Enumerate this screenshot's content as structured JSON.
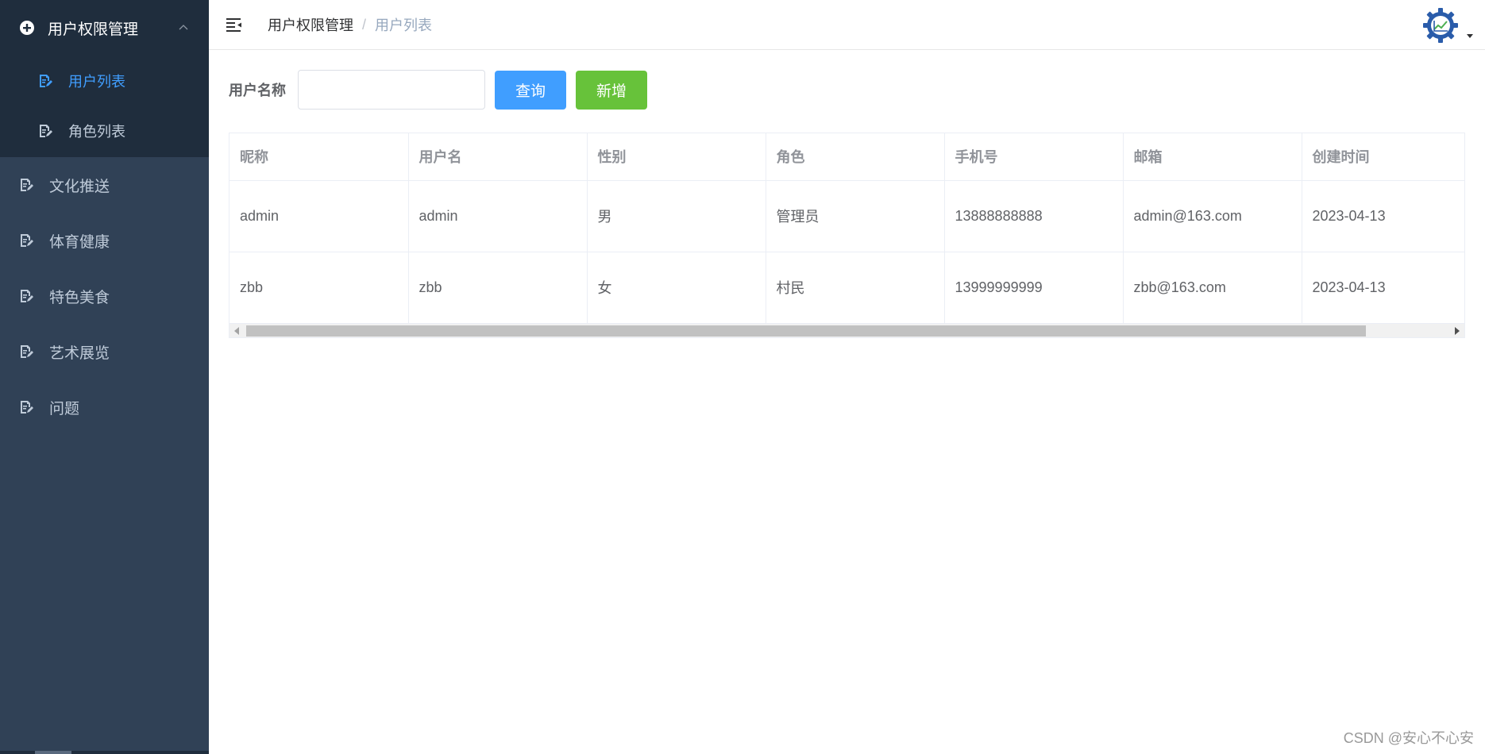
{
  "sidebar": {
    "group_title": "用户权限管理",
    "sub_items": [
      {
        "label": "用户列表",
        "active": true
      },
      {
        "label": "角色列表",
        "active": false
      }
    ],
    "items": [
      {
        "label": "文化推送"
      },
      {
        "label": "体育健康"
      },
      {
        "label": "特色美食"
      },
      {
        "label": "艺术展览"
      },
      {
        "label": "问题"
      }
    ]
  },
  "breadcrumb": {
    "parent": "用户权限管理",
    "separator": "/",
    "current": "用户列表"
  },
  "filter": {
    "label": "用户名称",
    "input_value": "",
    "query_label": "查询",
    "add_label": "新增"
  },
  "table": {
    "columns": [
      "昵称",
      "用户名",
      "性别",
      "角色",
      "手机号",
      "邮箱",
      "创建时间"
    ],
    "rows": [
      [
        "admin",
        "admin",
        "男",
        "管理员",
        "13888888888",
        "admin@163.com",
        "2023-04-13"
      ],
      [
        "zbb",
        "zbb",
        "女",
        "村民",
        "13999999999",
        "zbb@163.com",
        "2023-04-13"
      ]
    ]
  },
  "watermark": "CSDN @安心不心安",
  "colors": {
    "sidebar_bg": "#304156",
    "sidebar_group_bg": "#1f2d3d",
    "accent": "#409eff",
    "success": "#67c23a"
  }
}
